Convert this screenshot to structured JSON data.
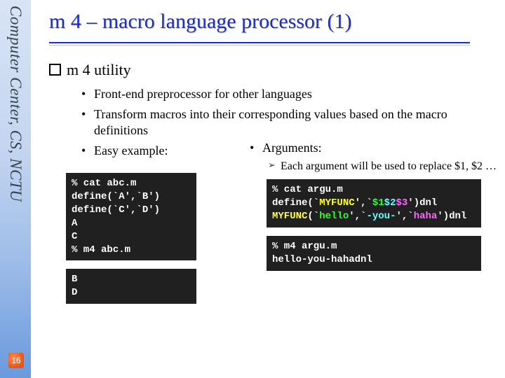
{
  "sidebar": {
    "label": "Computer Center, CS, NCTU",
    "page_number": "16"
  },
  "title": "m 4 – macro language processor (1)",
  "section_heading": "m 4 utility",
  "bullets": [
    "Front-end preprocessor for other languages",
    "Transform macros into their corresponding values based on the macro definitions",
    "Easy example:"
  ],
  "arguments": {
    "heading": "Arguments:",
    "sub": "Each argument will be used to replace $1, $2 …"
  },
  "code_left_1": "% cat abc.m\ndefine(`A',`B')\ndefine(`C',`D')\nA\nC\n% m4 abc.m",
  "code_left_2": "B\nD",
  "code_right_1_prefix": "% cat argu.m\ndefine(`",
  "code_right_1_myfunc": "MYFUNC",
  "code_right_1_mid": "',`",
  "code_right_1_a1": "$1",
  "code_right_1_a2": "$2",
  "code_right_1_a3": "$3",
  "code_right_1_end1": "')dnl\n",
  "code_right_1_call": "MYFUNC",
  "code_right_1_open": "(`",
  "code_right_1_p1": "hello",
  "code_right_1_sep": "',`",
  "code_right_1_p2": "-you-",
  "code_right_1_p3": "haha",
  "code_right_1_close": "')dnl",
  "code_right_2": "% m4 argu.m\nhello-you-hahadnl"
}
